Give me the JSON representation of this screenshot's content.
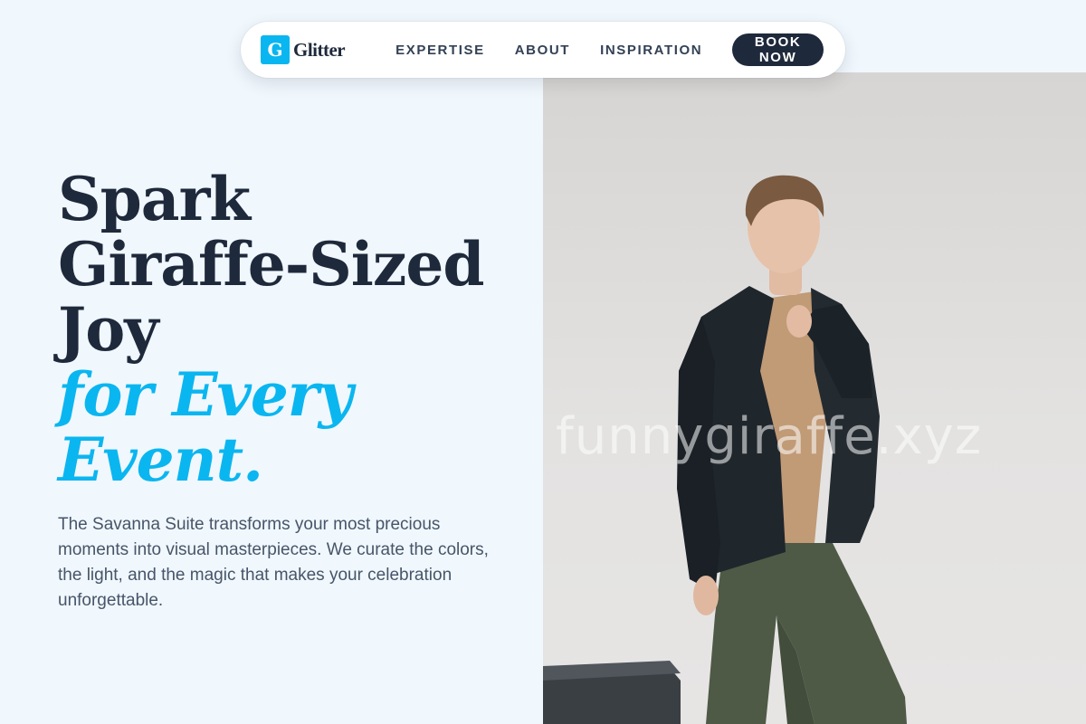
{
  "nav": {
    "brand_initial": "G",
    "brand_name": "Glitter",
    "links": [
      "EXPERTISE",
      "ABOUT",
      "INSPIRATION"
    ],
    "cta": "BOOK NOW"
  },
  "hero": {
    "headline_lines": [
      "Spark",
      "Giraffe-Sized",
      "Joy"
    ],
    "accent_lines": [
      "for Every",
      "Event."
    ],
    "description": "The Savanna Suite transforms your most precious moments into visual masterpieces. We curate the colors, the light, and the magic that makes your celebration unforgettable."
  },
  "photo": {
    "watermark": "funnygiraffe.xyz"
  },
  "colors": {
    "accent": "#0ab6f0",
    "dark": "#1e293b",
    "background": "#f0f7fd"
  }
}
